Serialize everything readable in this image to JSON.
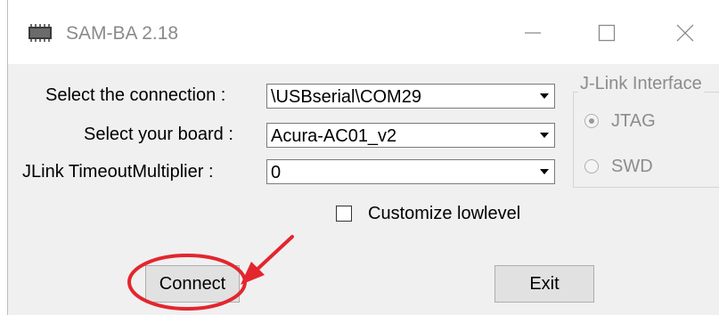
{
  "window": {
    "title": "SAM-BA 2.18"
  },
  "form": {
    "connection_label": "Select the connection :",
    "connection_value": "\\USBserial\\COM29",
    "board_label": "Select your board :",
    "board_value": "Acura-AC01_v2",
    "timeout_label": "JLink TimeoutMultiplier :",
    "timeout_value": "0"
  },
  "jlink": {
    "group_title": "J-Link Interface",
    "options": [
      {
        "label": "JTAG",
        "selected": true
      },
      {
        "label": "SWD",
        "selected": false
      }
    ]
  },
  "customize": {
    "label": "Customize lowlevel",
    "checked": false
  },
  "buttons": {
    "connect": "Connect",
    "exit": "Exit"
  },
  "annotation": {
    "color": "#e3262e"
  }
}
